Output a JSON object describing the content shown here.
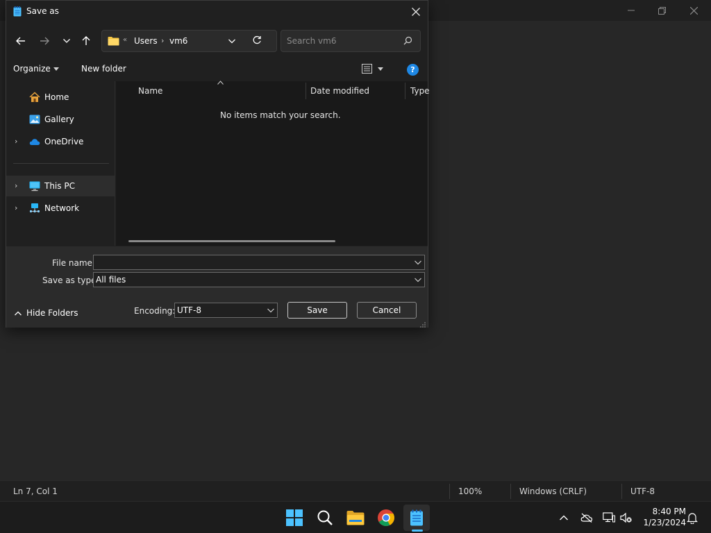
{
  "background_window": {
    "status": {
      "position": "Ln 7, Col 1",
      "zoom": "100%",
      "line_ending": "Windows (CRLF)",
      "encoding": "UTF-8"
    }
  },
  "dialog": {
    "title": "Save as",
    "address": {
      "overflow": "«",
      "crumbs": [
        "Users",
        "vm6"
      ],
      "separator": "›"
    },
    "search_placeholder": "Search vm6",
    "toolbar": {
      "organize": "Organize",
      "new_folder": "New folder",
      "help": "?"
    },
    "nav": {
      "home": "Home",
      "gallery": "Gallery",
      "onedrive": "OneDrive",
      "this_pc": "This PC",
      "network": "Network"
    },
    "columns": {
      "name": "Name",
      "date_modified": "Date modified",
      "type": "Type"
    },
    "empty_message": "No items match your search.",
    "file_name_label": "File name:",
    "file_name_value": "",
    "save_as_type_label": "Save as type:",
    "save_as_type_value": "All files",
    "encoding_label": "Encoding:",
    "encoding_value": "UTF-8",
    "save_button": "Save",
    "cancel_button": "Cancel",
    "hide_folders": "Hide Folders"
  },
  "taskbar": {
    "time": "8:40 PM",
    "date": "1/23/2024"
  },
  "colors": {
    "accent": "#4cc2ff",
    "help_blue": "#1e88e5",
    "folder_yellow": "#f4c542"
  }
}
